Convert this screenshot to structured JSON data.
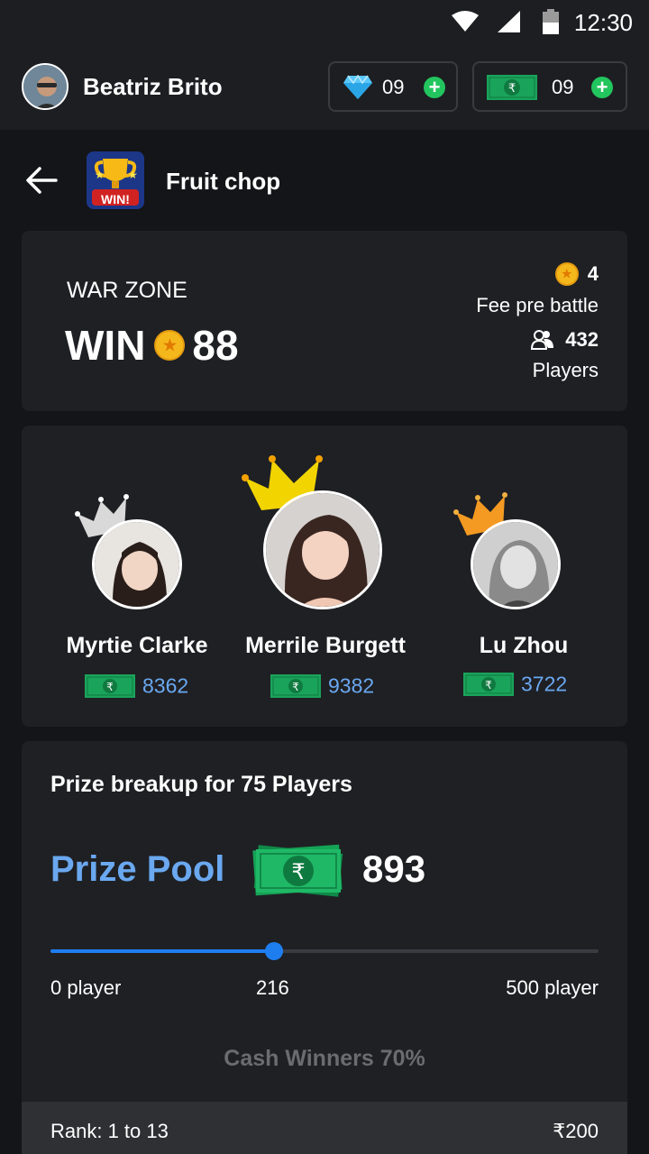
{
  "status_bar": {
    "time": "12:30"
  },
  "user": {
    "name": "Beatriz Brito"
  },
  "wallet": {
    "gems": "09",
    "cash": "09"
  },
  "game": {
    "title": "Fruit chop",
    "icon_text": "WIN!"
  },
  "war_zone": {
    "label": "WAR ZONE",
    "win_prefix": "WIN",
    "win_amount": "88",
    "fee": "4",
    "fee_label": "Fee pre battle",
    "players": "432",
    "players_label": "Players"
  },
  "leaders": [
    {
      "name": "Myrtie Clarke",
      "score": "8362",
      "crown_color": "#d9d9d9"
    },
    {
      "name": "Merrile Burgett",
      "score": "9382",
      "crown_color": "#f2d400"
    },
    {
      "name": "Lu Zhou",
      "score": "3722",
      "crown_color": "#f49a22"
    }
  ],
  "prize": {
    "title": "Prize breakup for 75 Players",
    "pool_label": "Prize Pool",
    "pool_amount": "893",
    "slider_min_label": "0 player",
    "slider_value_label": "216",
    "slider_max_label": "500 player",
    "slider_fraction": 0.408,
    "cash_winners": "Cash Winners 70%",
    "rank_label": "Rank: 1 to 13",
    "rank_prize": "₹200"
  },
  "colors": {
    "accent_blue": "#6aa8f0",
    "slider_blue": "#1e7ef0",
    "plus_green": "#22c55e",
    "coin_gold": "#f5b81c",
    "card_bg": "#1f2024"
  },
  "icons": [
    "wifi-icon",
    "signal-icon",
    "battery-icon",
    "diamond-icon",
    "plus-icon",
    "rupee-note-icon",
    "back-arrow-icon",
    "coin-icon",
    "players-icon",
    "crown-icon"
  ]
}
